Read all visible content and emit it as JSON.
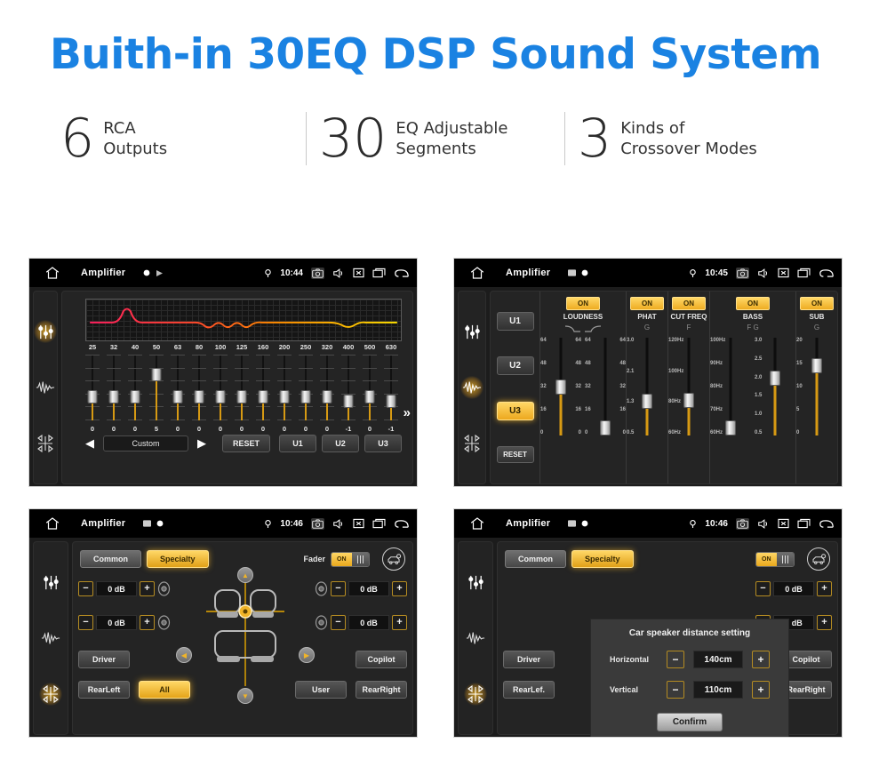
{
  "hero": {
    "title": "Buith-in 30EQ DSP Sound System",
    "color": "#1a82e2"
  },
  "stats": [
    {
      "number": "6",
      "line1": "RCA",
      "line2": "Outputs"
    },
    {
      "number": "30",
      "line1": "EQ Adjustable",
      "line2": "Segments"
    },
    {
      "number": "3",
      "line1": "Kinds of",
      "line2": "Crossover Modes"
    }
  ],
  "panels": {
    "eq": {
      "statusbar": {
        "title": "Amplifier",
        "time": "10:44"
      },
      "frequencies": [
        "25",
        "32",
        "40",
        "50",
        "63",
        "80",
        "100",
        "125",
        "160",
        "200",
        "250",
        "320",
        "400",
        "500",
        "630"
      ],
      "values": [
        "0",
        "0",
        "0",
        "5",
        "0",
        "0",
        "0",
        "0",
        "0",
        "0",
        "0",
        "0",
        "-1",
        "0",
        "-1"
      ],
      "preset": "Custom",
      "reset_label": "RESET",
      "user_presets": [
        "U1",
        "U2",
        "U3"
      ],
      "more_label": "»"
    },
    "dsp": {
      "statusbar": {
        "title": "Amplifier",
        "time": "10:45"
      },
      "side_buttons": [
        "U1",
        "U2",
        "U3"
      ],
      "side_active": "U3",
      "reset_label": "RESET",
      "columns": [
        {
          "name": "LOUDNESS",
          "state": "ON",
          "sub": "",
          "sliders": [
            {
              "scale": [
                "64",
                "48",
                "32",
                "16",
                "0"
              ],
              "value": 32,
              "max": 64
            },
            {
              "scale": [
                "64",
                "48",
                "32",
                "16",
                "0"
              ],
              "value": 0,
              "max": 64
            }
          ]
        },
        {
          "name": "PHAT",
          "state": "ON",
          "sub": "G",
          "sliders": [
            {
              "scale": [
                "3.0",
                "2.1",
                "1.3",
                "0.5"
              ],
              "value": 1.3,
              "max": 3.0
            }
          ]
        },
        {
          "name": "CUT FREQ",
          "state": "ON",
          "sub": "F",
          "sliders": [
            {
              "scale": [
                "120Hz",
                "100Hz",
                "80Hz",
                "60Hz"
              ],
              "value": 80,
              "max": 120
            }
          ]
        },
        {
          "name": "BASS",
          "state": "ON",
          "sub": "F   G",
          "sliders": [
            {
              "scale": [
                "100Hz",
                "90Hz",
                "80Hz",
                "70Hz",
                "60Hz"
              ],
              "value": 60,
              "max": 100
            },
            {
              "scale": [
                "3.0",
                "2.5",
                "2.0",
                "1.5",
                "1.0",
                "0.5"
              ],
              "value": 2.0,
              "max": 3.0
            }
          ]
        },
        {
          "name": "SUB",
          "state": "ON",
          "sub": "G",
          "sliders": [
            {
              "scale": [
                "20",
                "15",
                "10",
                "5",
                "0"
              ],
              "value": 15,
              "max": 20
            }
          ]
        }
      ]
    },
    "fader": {
      "statusbar": {
        "title": "Amplifier",
        "time": "10:46"
      },
      "tabs": [
        {
          "label": "Common",
          "active": false
        },
        {
          "label": "Specialty",
          "active": true
        }
      ],
      "fader_label": "Fader",
      "fader_state": "ON",
      "steppers": [
        {
          "value": "0 dB"
        },
        {
          "value": "0 dB"
        },
        {
          "value": "0 dB"
        },
        {
          "value": "0 dB"
        }
      ],
      "minus": "−",
      "plus": "+",
      "buttons": [
        {
          "label": "Driver",
          "active": false
        },
        {
          "label": "Copilot",
          "active": false
        },
        {
          "label": "RearLeft",
          "active": false
        },
        {
          "label": "All",
          "active": true
        },
        {
          "label": "User",
          "active": false
        },
        {
          "label": "RearRight",
          "active": false
        }
      ]
    },
    "distance": {
      "statusbar": {
        "title": "Amplifier",
        "time": "10:46"
      },
      "tabs": [
        {
          "label": "Common",
          "active": false
        },
        {
          "label": "Specialty",
          "active": true
        }
      ],
      "fader_state": "ON",
      "steppers": [
        {
          "value": "0 dB"
        },
        {
          "value": "0 dB"
        }
      ],
      "buttons": [
        {
          "label": "Driver",
          "active": false
        },
        {
          "label": "Copilot",
          "active": false
        },
        {
          "label": "RearLef.",
          "active": false
        },
        {
          "label": "RearRight",
          "active": false
        }
      ],
      "dialog": {
        "title": "Car speaker distance setting",
        "rows": [
          {
            "label": "Horizontal",
            "value": "140cm"
          },
          {
            "label": "Vertical",
            "value": "110cm"
          }
        ],
        "confirm_label": "Confirm",
        "minus": "−",
        "plus": "+"
      }
    }
  }
}
